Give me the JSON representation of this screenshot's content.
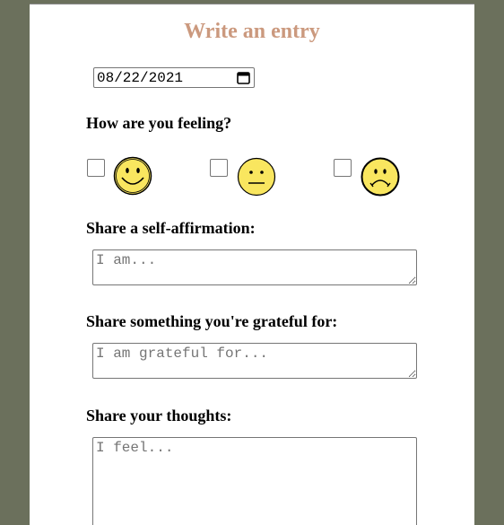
{
  "page": {
    "title": "Write an entry"
  },
  "date": {
    "value": "08/22/2021",
    "icon": "calendar-icon"
  },
  "mood": {
    "heading": "How are you feeling?",
    "options": [
      {
        "name": "happy",
        "icon": "happy-face-icon",
        "checked": false
      },
      {
        "name": "neutral",
        "icon": "neutral-face-icon",
        "checked": false
      },
      {
        "name": "sad",
        "icon": "sad-face-icon",
        "checked": false
      }
    ]
  },
  "affirmation": {
    "heading": "Share a self-affirmation:",
    "placeholder": "I am..."
  },
  "gratitude": {
    "heading": "Share something you're grateful for:",
    "placeholder": "I am grateful for..."
  },
  "thoughts": {
    "heading": "Share your thoughts:",
    "placeholder": "I feel..."
  },
  "colors": {
    "background": "#6b705c",
    "card": "#ffffff",
    "title": "#cb997e",
    "face_fill": "#f9e65f"
  }
}
